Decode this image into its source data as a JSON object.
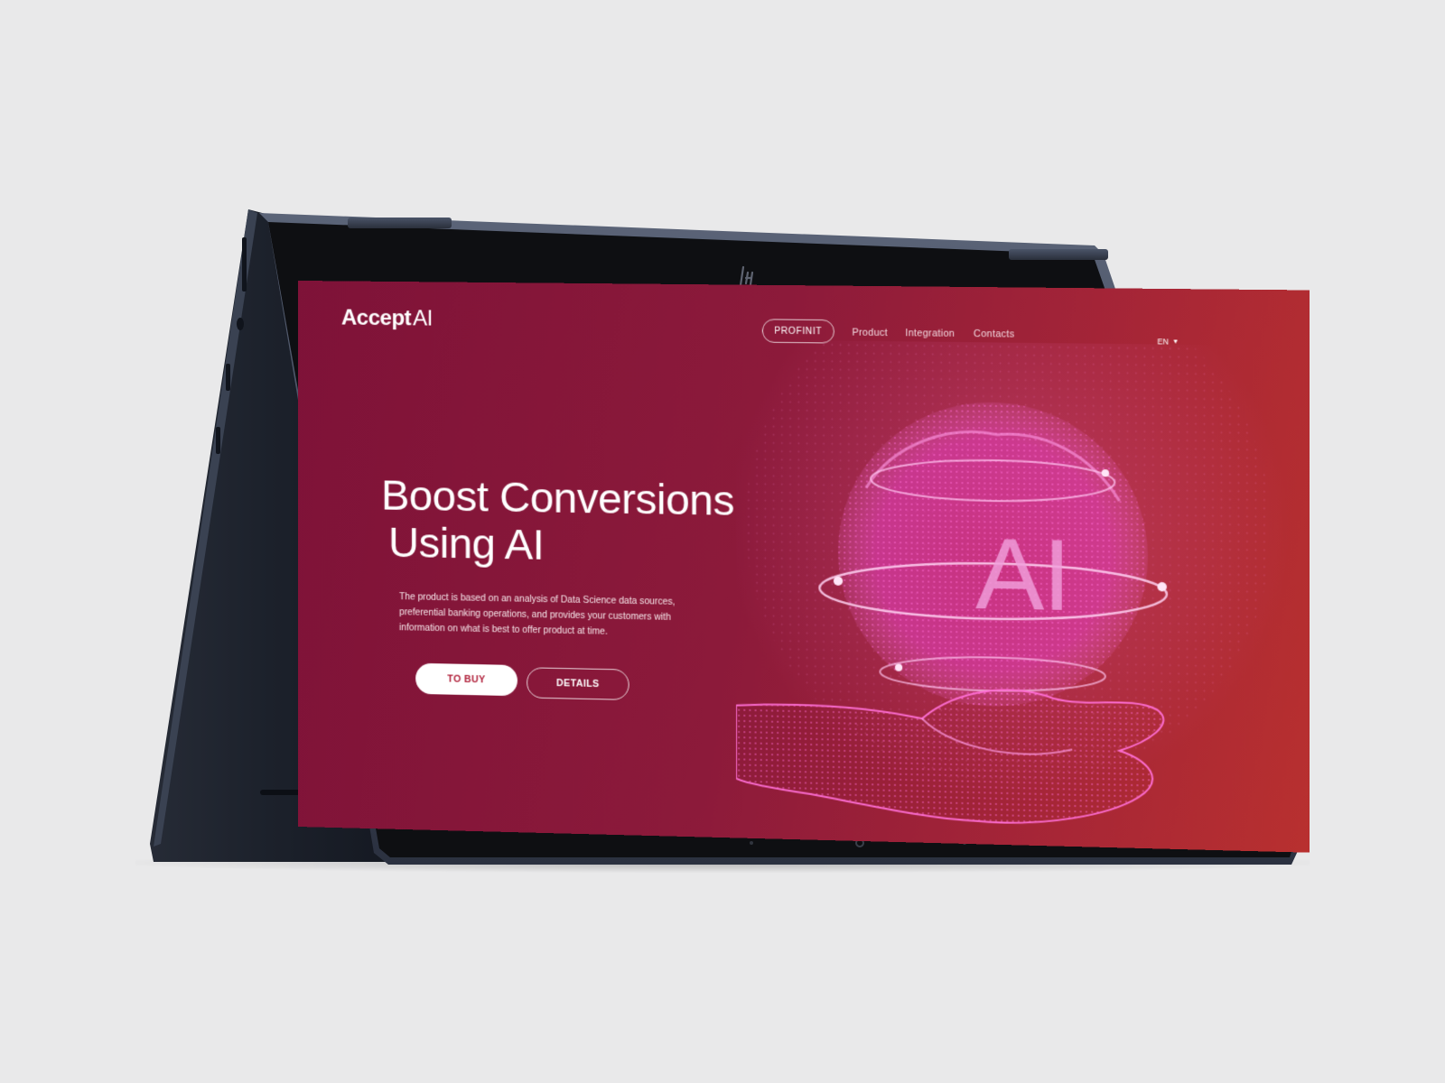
{
  "device": {
    "brand_logo_icon": "hp-logo-icon"
  },
  "site": {
    "logo": {
      "bold": "Accept",
      "light": "AI"
    },
    "nav": {
      "highlight": "PROFINIT",
      "links": [
        "Product",
        "Integration",
        "Contacts"
      ],
      "language": "EN",
      "language_caret_icon": "caret-down-icon"
    },
    "hero": {
      "title_line1": "Boost Conversions",
      "title_line2": "Using AI",
      "description": "The product is based on an analysis of Data Science data sources, preferential banking operations, and provides your customers with information on what is best to offer product at time.",
      "primary_button": "TO BUY",
      "secondary_button": "DETAILS",
      "illustration_text": "AI",
      "illustration_icon": "ai-sphere-hand-icon"
    },
    "colors": {
      "gradient_start": "#7e1238",
      "gradient_end": "#b8302f",
      "accent_magenta": "#e43fbf",
      "button_text": "#b0203a"
    }
  }
}
